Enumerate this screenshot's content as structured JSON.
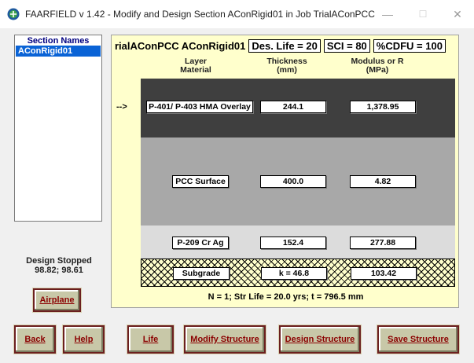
{
  "window": {
    "title": "FAARFIELD v 1.42 - Modify and Design Section AConRigid01 in Job TrialAConPCC",
    "minimize": "—",
    "maximize": "☐",
    "close": "✕"
  },
  "section_list": {
    "header": "Section Names",
    "items": [
      "AConRigid01"
    ]
  },
  "design_status": {
    "line1": "Design Stopped",
    "line2": "98.82;  98.61"
  },
  "panel": {
    "job_section": "rialAConPCC  AConRigid01",
    "des_life": "Des. Life = 20",
    "sci": "SCI = 80",
    "cdfu": "%CDFU = 100",
    "col_material": "Layer\nMaterial",
    "col_thickness": "Thickness\n(mm)",
    "col_modulus": "Modulus or R\n(MPa)",
    "layers": [
      {
        "material": "P-401/ P-403 HMA Overlay",
        "thickness": "244.1",
        "modulus": "1,378.95",
        "color": "#3f3f3f",
        "current_marker": "-->"
      },
      {
        "material": "PCC Surface",
        "thickness": "400.0",
        "modulus": "4.82",
        "color": "#a8a8a8"
      },
      {
        "material": "P-209 Cr Ag",
        "thickness": "152.4",
        "modulus": "277.88",
        "color": "#dcdcdc"
      },
      {
        "material": "Subgrade",
        "thickness": "k = 46.8",
        "modulus": "103.42",
        "color": "#ffffcc"
      }
    ],
    "summary": "N = 1; Str Life = 20.0 yrs; t = 796.5 mm"
  },
  "buttons": {
    "airplane": "Airplane",
    "back": "Back",
    "help": "Help",
    "life": "Life",
    "modify_structure": "Modify Structure",
    "design_structure": "Design Structure",
    "save_structure": "Save Structure"
  }
}
